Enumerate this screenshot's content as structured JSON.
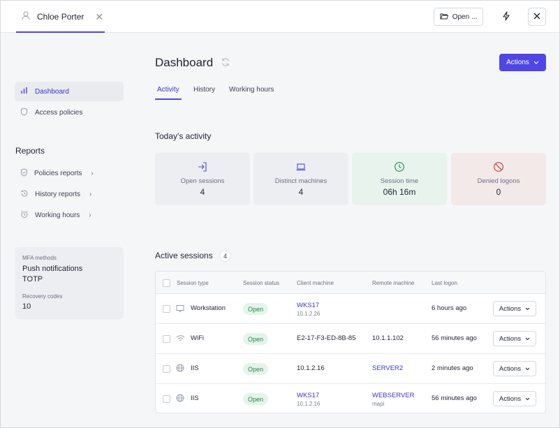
{
  "topbar": {
    "user_name": "Chloe Porter",
    "open_label": "Open ..."
  },
  "sidebar": {
    "items": [
      {
        "label": "Dashboard",
        "icon": "bar-chart-icon",
        "active": true
      },
      {
        "label": "Access policies",
        "icon": "shield-icon",
        "active": false
      }
    ],
    "reports_title": "Reports",
    "reports": [
      {
        "label": "Policies reports",
        "icon": "shield-check-icon"
      },
      {
        "label": "History reports",
        "icon": "history-icon"
      },
      {
        "label": "Working hours",
        "icon": "alarm-clock-icon"
      }
    ],
    "mfa": {
      "methods_label": "MFA methods",
      "methods": [
        "Push notifications",
        "TOTP"
      ],
      "recovery_label": "Recovery codes",
      "recovery_value": "10"
    }
  },
  "main": {
    "title": "Dashboard",
    "actions_label": "Actions",
    "tabs": [
      "Activity",
      "History",
      "Working hours"
    ],
    "today_title": "Today's activity",
    "stats": [
      {
        "label": "Open sessions",
        "value": "4",
        "icon": "login-icon"
      },
      {
        "label": "Distinct machines",
        "value": "4",
        "icon": "laptop-icon"
      },
      {
        "label": "Session time",
        "value": "06h 16m",
        "icon": "clock-icon"
      },
      {
        "label": "Denied logons",
        "value": "0",
        "icon": "forbidden-icon"
      }
    ],
    "sessions_title": "Active sessions",
    "sessions_count": "4",
    "table": {
      "headers": [
        "Session type",
        "Session status",
        "Client machine",
        "Remote machine",
        "Last logon"
      ],
      "rows": [
        {
          "type": "Workstation",
          "icon": "monitor-icon",
          "status": "Open",
          "client": "WKS17",
          "client_ip": "10.1.2.26",
          "remote": "",
          "remote_sub": "",
          "last": "6 hours ago",
          "action": "Actions"
        },
        {
          "type": "WiFi",
          "icon": "wifi-icon",
          "status": "Open",
          "client": "E2-17-F3-ED-8B-85",
          "client_ip": "",
          "remote": "10.1.1.102",
          "remote_sub": "",
          "last": "56 minutes ago",
          "action": "Actions"
        },
        {
          "type": "IIS",
          "icon": "globe-icon",
          "status": "Open",
          "client": "10.1.2.16",
          "client_ip": "",
          "remote": "SERVER2",
          "remote_sub": "",
          "last": "2 minutes ago",
          "action": "Actions"
        },
        {
          "type": "IIS",
          "icon": "globe-icon",
          "status": "Open",
          "client": "WKS17",
          "client_ip": "10.1.2.16",
          "remote": "WEBSERVER",
          "remote_sub": "mapi",
          "last": "56 minutes ago",
          "action": "Actions"
        }
      ]
    }
  },
  "colors": {
    "accent": "#4f46e5",
    "open_status_bg": "#e5f4ea",
    "open_status_text": "#1f8a46",
    "card_session_time_bg": "#e8f3ee",
    "card_denied_bg": "#f3e9e9"
  }
}
